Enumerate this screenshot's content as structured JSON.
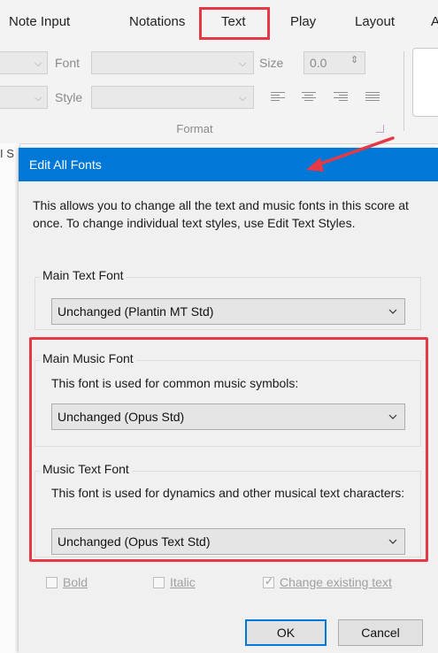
{
  "ribbon": {
    "tabs": [
      "Note Input",
      "Notations",
      "Text",
      "Play",
      "Layout",
      "A"
    ],
    "selected_tab_highlight": "Text",
    "font_label": "Font",
    "style_label": "Style",
    "size_label": "Size",
    "size_value": "0.0",
    "group_label": "Format"
  },
  "left_strip": {
    "text": "I S"
  },
  "dialog": {
    "title": "Edit All Fonts",
    "intro": "This allows you to change all the text and music fonts in this score at once. To change individual text styles, use Edit Text Styles.",
    "main_text": {
      "group_title": "Main Text Font",
      "value": "Unchanged (Plantin MT Std)"
    },
    "main_music": {
      "group_title": "Main Music Font",
      "description": "This font is used for common music symbols:",
      "value": "Unchanged (Opus Std)"
    },
    "music_text": {
      "group_title": "Music Text Font",
      "description": "This font is used for dynamics and other musical text characters:",
      "value": "Unchanged (Opus Text Std)"
    },
    "options": {
      "bold": "Bold",
      "italic": "Italic",
      "change_existing": "Change existing text",
      "change_existing_checked": true
    },
    "buttons": {
      "ok": "OK",
      "cancel": "Cancel"
    }
  },
  "colors": {
    "titlebar": "#0078d7",
    "highlight": "#e63946",
    "dialog_bg": "#f0f0f0"
  }
}
